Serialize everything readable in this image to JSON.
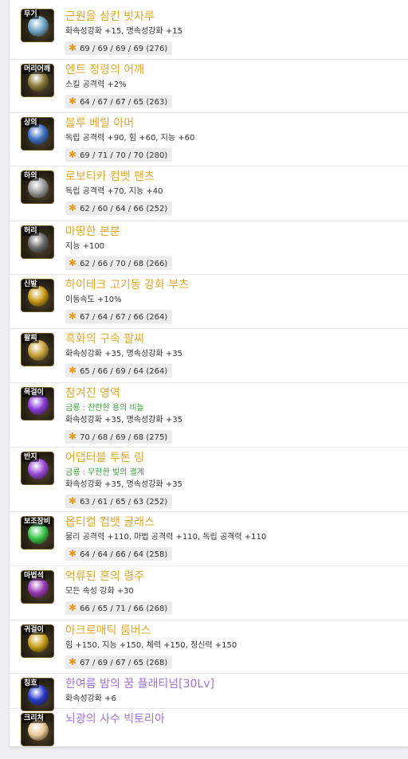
{
  "items": [
    {
      "slot": "무기",
      "name": "근원을 삼킨 빗자루",
      "options": [
        "화속성강화 +15, 명속성강화 +15"
      ],
      "stats": "69 / 69 / 69 / 69 (276)",
      "color": "#6fa6c8"
    },
    {
      "slot": "머리어깨",
      "name": "엔트 정령의 어깨",
      "options": [
        "스킬 공격력 +2%"
      ],
      "stats": "64 / 67 / 67 / 65 (263)",
      "color": "#8a7a3a"
    },
    {
      "slot": "상의",
      "name": "블루 베릴 아머",
      "options": [
        "독립 공격력 +90, 힘 +60, 지능 +60"
      ],
      "stats": "69 / 71 / 70 / 70 (280)",
      "color": "#3a6fc2"
    },
    {
      "slot": "하의",
      "name": "로보티카 컴뱃 팬츠",
      "options": [
        "독립 공격력 +70, 지능 +40"
      ],
      "stats": "62 / 60 / 64 / 66 (252)",
      "color": "#9a9a9a"
    },
    {
      "slot": "허리",
      "name": "마땅한 본분",
      "options": [
        "지능 +100"
      ],
      "stats": "62 / 66 / 70 / 68 (266)",
      "color": "#6a6a6a"
    },
    {
      "slot": "신발",
      "name": "하이테크 고기동 강화 부츠",
      "options": [
        "이동속도 +10%"
      ],
      "stats": "67 / 64 / 67 / 66 (264)",
      "color": "#c89a1a"
    },
    {
      "slot": "팔찌",
      "name": "흑화의 구속 팔찌",
      "options": [
        "화속성강화 +35, 명속성강화 +35"
      ],
      "stats": "65 / 66 / 69 / 64 (264)",
      "color": "#c8a23a"
    },
    {
      "slot": "목걸이",
      "name": "잠겨진 영역",
      "options": [
        "금룡 : 찬란한 용의 비늘",
        "화속성강화 +35, 명속성강화 +35"
      ],
      "greenFirst": true,
      "stats": "70 / 68 / 69 / 68 (275)",
      "color": "#8a3ad8"
    },
    {
      "slot": "반지",
      "name": "어댑터블 투톤 링",
      "options": [
        "금룡 : 무한한 빛의 결계",
        "화속성강화 +35, 명속성강화 +35"
      ],
      "greenFirst": true,
      "stats": "63 / 61 / 65 / 63 (252)",
      "color": "#9a4ad8"
    },
    {
      "slot": "보조장비",
      "name": "옵티컬 컴뱃 글래스",
      "options": [
        "물리 공격력 +110, 마법 공격력 +110, 독립 공격력 +110"
      ],
      "stats": "64 / 64 / 66 / 64 (258)",
      "color": "#3ac84a"
    },
    {
      "slot": "마법석",
      "name": "억류된 혼의 령주",
      "options": [
        "모든 속성 강화 +30"
      ],
      "stats": "66 / 65 / 71 / 66 (268)",
      "color": "#9a3ab8"
    },
    {
      "slot": "귀걸이",
      "name": "아크로매틱 룸버스",
      "options": [
        "힘 +150, 지능 +150, 체력 +150, 정신력 +150"
      ],
      "stats": "67 / 69 / 67 / 65 (268)",
      "color": "#c8a21a"
    },
    {
      "slot": "칭호",
      "name": "한여름 밤의 꿈 플래티넘[30Lv]",
      "options": [
        "화속성강화 +6"
      ],
      "purple": true,
      "color": "#2a3ac8"
    },
    {
      "slot": "크리처",
      "name": "뇌광의 사수 빅토리아",
      "options": [],
      "purple": true,
      "color": "#e8c898"
    }
  ],
  "colors": {
    "gold_name": "#e0a92b",
    "purple_name": "#a273d8",
    "green_option": "#39a03a",
    "star": "#e69b22"
  },
  "icons": {
    "stat_marker": "star-icon"
  }
}
